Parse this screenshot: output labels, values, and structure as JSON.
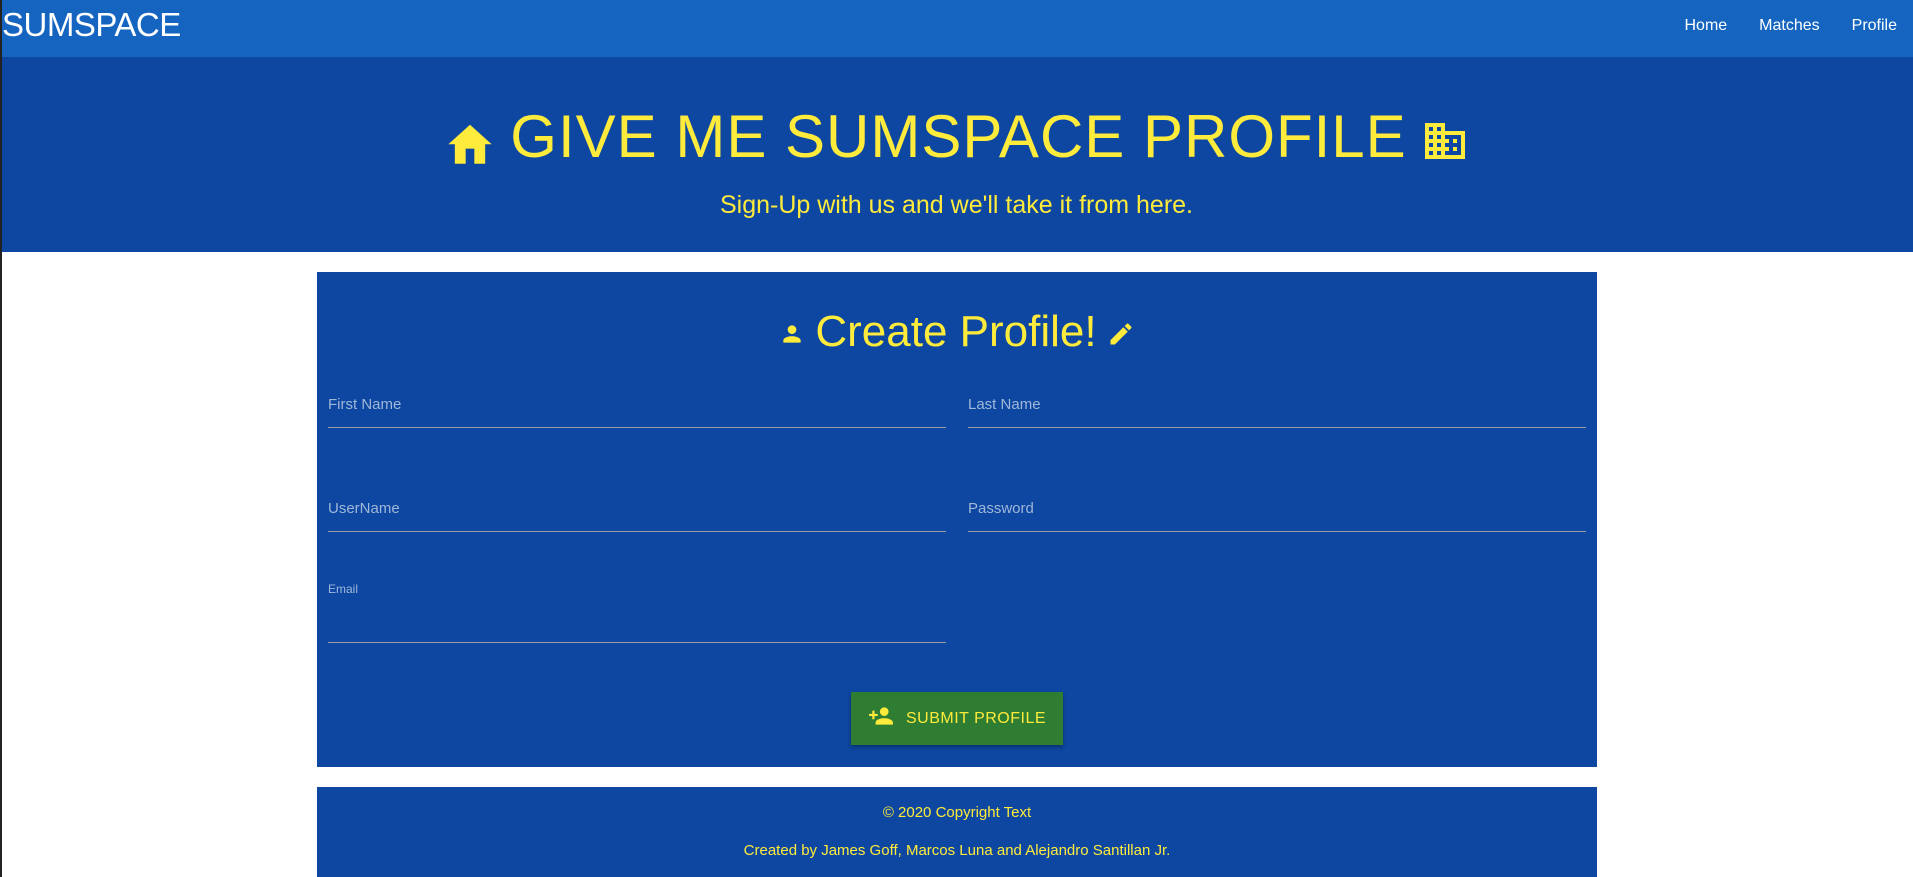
{
  "navbar": {
    "brand": "SUMSPACE",
    "links": [
      "Home",
      "Matches",
      "Profile"
    ]
  },
  "hero": {
    "title": "GIVE ME SUMSPACE PROFILE",
    "subtitle": "Sign-Up with us and we'll take it from here.",
    "left_icon": "home-icon",
    "right_icon": "building-icon"
  },
  "form": {
    "title": "Create Profile!",
    "title_left_icon": "person-icon",
    "title_right_icon": "pencil-icon",
    "fields": {
      "first_name": {
        "label": "First Name",
        "value": ""
      },
      "last_name": {
        "label": "Last Name",
        "value": ""
      },
      "username": {
        "label": "UserName",
        "value": ""
      },
      "password": {
        "label": "Password",
        "value": ""
      },
      "email": {
        "label": "Email",
        "value": ""
      }
    },
    "submit_label": "SUBMIT PROFILE",
    "submit_icon": "person-add-icon"
  },
  "footer": {
    "copyright": "© 2020 Copyright Text",
    "credits": "Created by James Goff, Marcos Luna and Alejandro Santillan Jr."
  },
  "colors": {
    "navbar": "#1565c0",
    "primary": "#0d47a1",
    "accent": "#ffeb3b",
    "button": "#2e7d32"
  }
}
